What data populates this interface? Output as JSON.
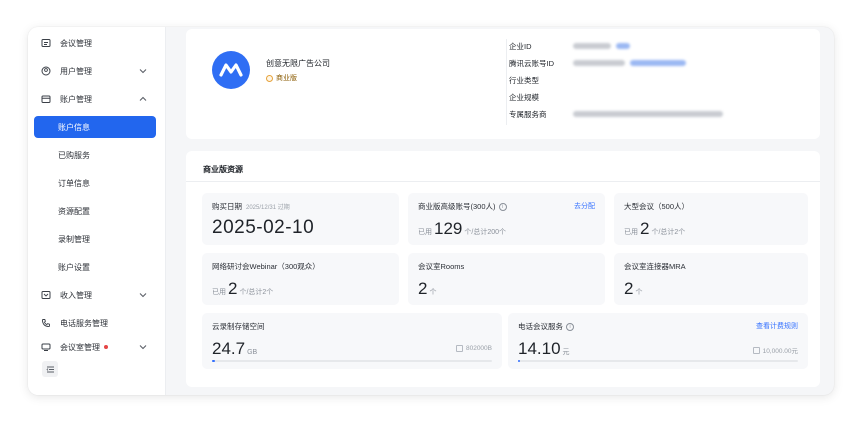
{
  "sidebar": {
    "items": [
      {
        "label": "会议管理",
        "icon": "calendar-icon"
      },
      {
        "label": "用户管理",
        "icon": "user-icon"
      },
      {
        "label": "账户管理",
        "icon": "account-icon"
      },
      {
        "label": "收入管理",
        "icon": "income-icon"
      },
      {
        "label": "电话服务管理",
        "icon": "phone-icon"
      },
      {
        "label": "会议室管理",
        "icon": "room-icon"
      }
    ],
    "sub_items": [
      "账户信息",
      "已购服务",
      "订单信息",
      "资源配置",
      "录制管理",
      "账户设置"
    ],
    "active_sub": "账户信息"
  },
  "profile": {
    "company_name": "创意无限广告公司",
    "badge": "商业版",
    "fields": [
      {
        "label": "企业ID"
      },
      {
        "label": "腾讯云账号ID"
      },
      {
        "label": "行业类型"
      },
      {
        "label": "企业规模"
      },
      {
        "label": "专属服务商"
      }
    ]
  },
  "resources": {
    "title": "商业版资源",
    "purchase": {
      "label": "购买日期",
      "expiry_note": "2025/12/31 过期",
      "date": "2025-02-10"
    },
    "advanced_accounts": {
      "label": "商业版高级账号(300人)",
      "link": "去分配",
      "used_prefix": "已用",
      "used": "129",
      "suffix": "个/总计200个"
    },
    "large_meeting": {
      "label": "大型会议（500人）",
      "used_prefix": "已用",
      "used": "2",
      "suffix": "个/总计2个"
    },
    "webinar": {
      "label": "网络研讨会Webinar（300观众）",
      "used_prefix": "已用",
      "used": "2",
      "suffix": "个/总计2个"
    },
    "rooms": {
      "label": "会议室Rooms",
      "value": "2",
      "unit": "个"
    },
    "mra": {
      "label": "会议室连接器MRA",
      "value": "2",
      "unit": "个"
    },
    "cloud_storage": {
      "label": "云录制存储空间",
      "value": "24.7",
      "unit": "GB",
      "total": "802000B"
    },
    "phone_service": {
      "label": "电话会议服务",
      "link": "查看计费规则",
      "value": "14.10",
      "unit": "元",
      "total": "10,000.00元"
    }
  },
  "colors": {
    "accent": "#2266ee",
    "logo": "#2f6ef4"
  }
}
